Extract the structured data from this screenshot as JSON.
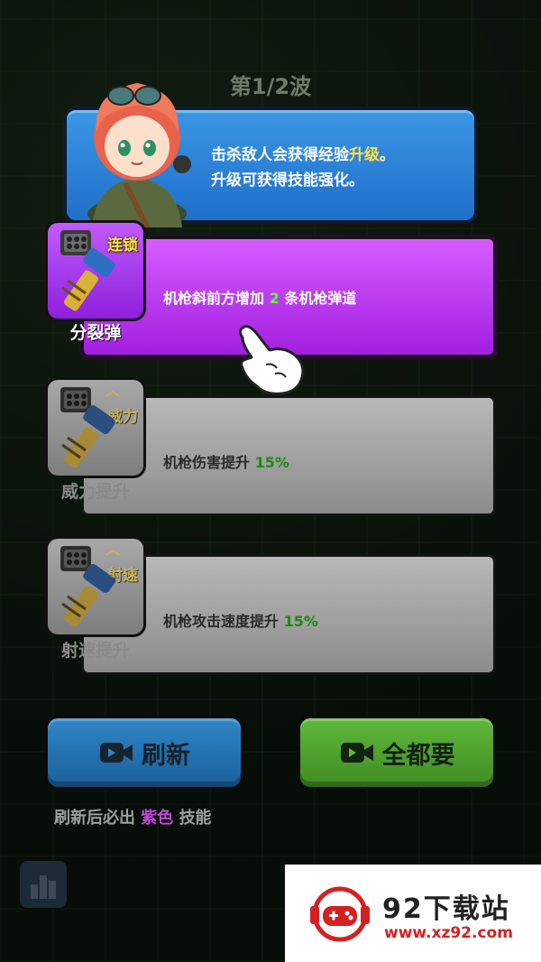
{
  "wave": {
    "label": "第1/2波"
  },
  "tutorial": {
    "line1_prefix": "击杀敌人会获得经验",
    "line1_highlight": "升级",
    "line1_suffix": "。",
    "line2": "升级可获得技能强化。"
  },
  "skills": [
    {
      "name": "分裂弹",
      "tag": "连锁",
      "desc_prefix": "机枪斜前方增加",
      "desc_value": "2",
      "desc_suffix": "条机枪弹道",
      "rarity": "purple",
      "icon": "machine-gun-icon"
    },
    {
      "name": "威力提升",
      "tag": "威力",
      "desc_prefix": "机枪伤害提升",
      "desc_value": "15%",
      "desc_suffix": "",
      "rarity": "gray",
      "icon": "machine-gun-icon"
    },
    {
      "name": "射速提升",
      "tag": "射速",
      "desc_prefix": "机枪攻击速度提升",
      "desc_value": "15%",
      "desc_suffix": "",
      "rarity": "gray",
      "icon": "machine-gun-icon"
    }
  ],
  "buttons": {
    "refresh": "刷新",
    "take_all": "全都要"
  },
  "hint": {
    "prefix": "刷新后必出",
    "highlight": "紫色",
    "suffix": "技能"
  },
  "watermark": {
    "title": "92下载站",
    "url": "www.xz92.com"
  },
  "colors": {
    "purple_card": "#b83cf0",
    "gray_card": "#a0a0a0",
    "refresh_btn": "#2a7bbf",
    "take_all_btn": "#4fa32e",
    "tutorial_bg": "#2f86d8",
    "highlight_yellow": "#ffe14a",
    "value_green": "#5cff3c"
  }
}
